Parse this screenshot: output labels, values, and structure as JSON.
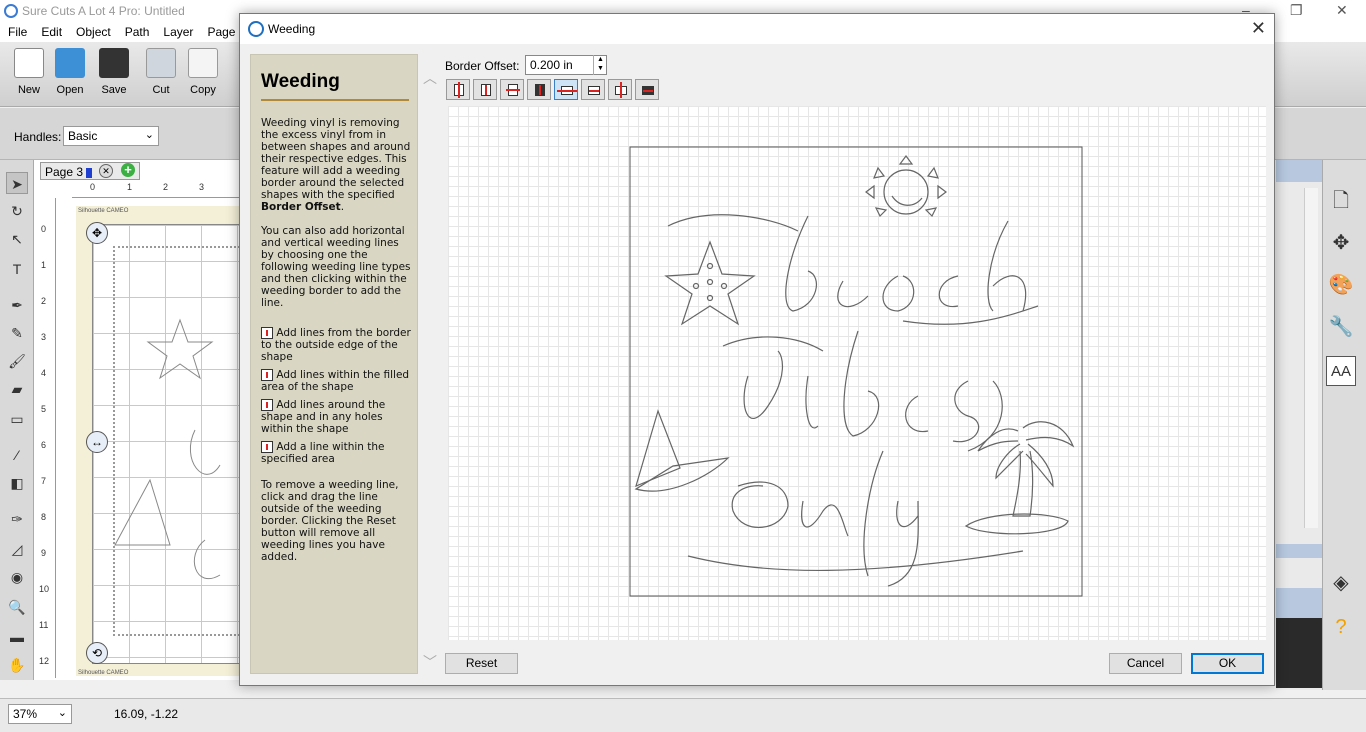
{
  "app": {
    "title": "Sure Cuts A Lot 4 Pro: Untitled"
  },
  "menu": [
    "File",
    "Edit",
    "Object",
    "Path",
    "Layer",
    "Page"
  ],
  "toolbar": [
    {
      "label": "New",
      "icon": "new-doc-icon"
    },
    {
      "label": "Open",
      "icon": "open-folder-icon"
    },
    {
      "label": "Save",
      "icon": "save-disk-icon"
    },
    {
      "label": "Cut",
      "icon": "scissors-icon"
    },
    {
      "label": "Copy",
      "icon": "copy-icon"
    }
  ],
  "handles": {
    "label": "Handles:",
    "value": "Basic"
  },
  "page_tab": {
    "label": "Page 3"
  },
  "ruler": {
    "top": [
      "0",
      "1",
      "2",
      "3"
    ],
    "left": [
      "0",
      "1",
      "2",
      "3",
      "4",
      "5",
      "6",
      "7",
      "8",
      "9",
      "10",
      "11",
      "12"
    ]
  },
  "mat_label": "Silhouette CAMEO",
  "status": {
    "zoom": "37%",
    "coords": "16.09, -1.22"
  },
  "dialog": {
    "title": "Weeding",
    "help": {
      "heading": "Weeding",
      "p1_text": "Weeding vinyl is removing the excess vinyl from in between shapes and around their respective edges. This feature will add a weeding border around the selected shapes with the specified ",
      "p1_bold": "Border Offset",
      "p1_end": ".",
      "p2": "You can also add horizontal and vertical weeding lines by choosing one the following weeding line types and then clicking within the weeding border to add the line.",
      "item1": "Add lines from the border to the outside edge of the shape",
      "item2": "Add lines within the filled area of the shape",
      "item3": "Add lines around the shape and in any holes within the shape",
      "item4": "Add a line within the specified area",
      "p3": "To remove a weeding line, click and drag the line outside of the weeding border. Clicking the Reset button will remove all weeding lines you have added."
    },
    "border_offset": {
      "label": "Border Offset:",
      "value": "0.200 in"
    },
    "line_buttons": [
      {
        "name": "vline-outside",
        "selected": false
      },
      {
        "name": "vline-filled",
        "selected": false
      },
      {
        "name": "vline-around",
        "selected": false
      },
      {
        "name": "vline-area",
        "selected": false
      },
      {
        "name": "hline-outside",
        "selected": true
      },
      {
        "name": "hline-filled",
        "selected": false
      },
      {
        "name": "hline-around",
        "selected": false
      },
      {
        "name": "hline-area",
        "selected": false
      }
    ],
    "buttons": {
      "reset": "Reset",
      "cancel": "Cancel",
      "ok": "OK"
    }
  }
}
